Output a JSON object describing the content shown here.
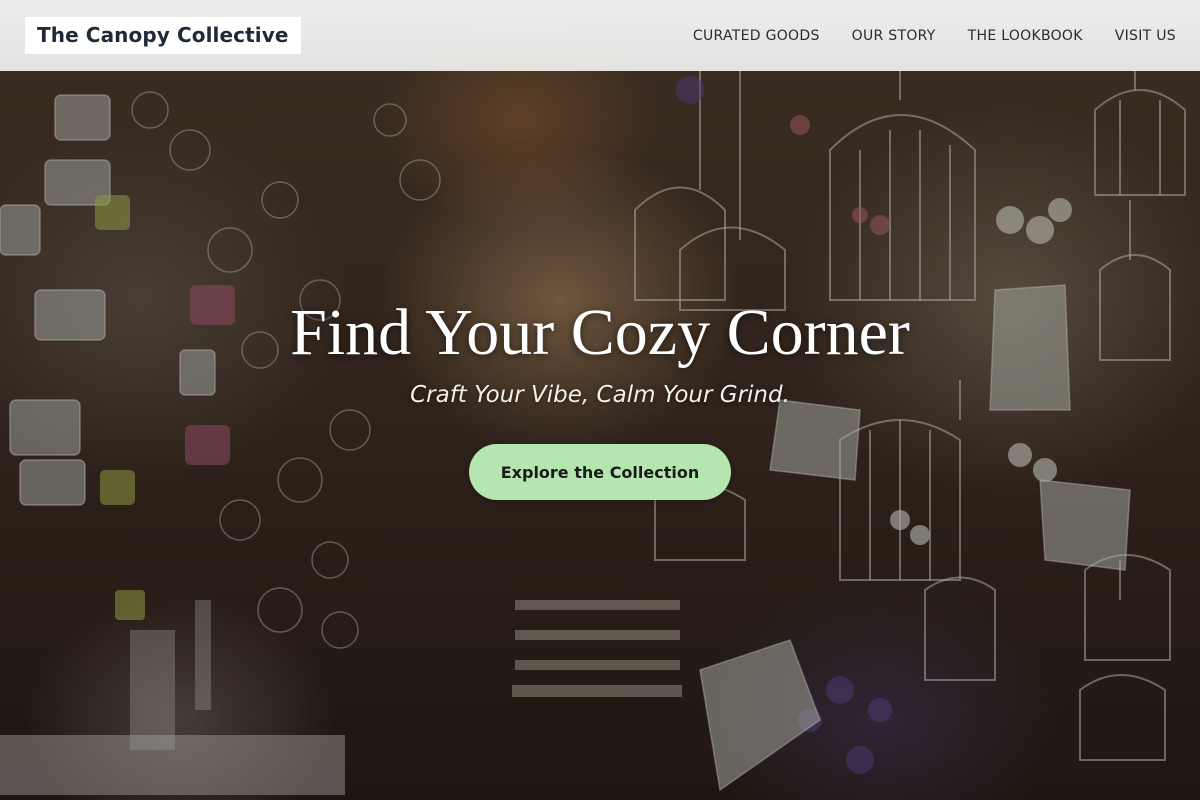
{
  "nav": {
    "brand": "The Canopy Collective",
    "links": [
      {
        "label": "CURATED GOODS"
      },
      {
        "label": "OUR STORY"
      },
      {
        "label": "THE LOOKBOOK"
      },
      {
        "label": "VISIT US"
      }
    ]
  },
  "hero": {
    "title": "Find Your Cozy Corner",
    "subtitle": "Craft Your Vibe, Calm Your Grind.",
    "cta_label": "Explore the Collection",
    "background_image": "hanging-birdcages-and-mugs-shop-photo"
  },
  "colors": {
    "cta_background": "#b5e6b0",
    "brand_text": "#1f2a37",
    "nav_background": "#f2f2f1"
  }
}
